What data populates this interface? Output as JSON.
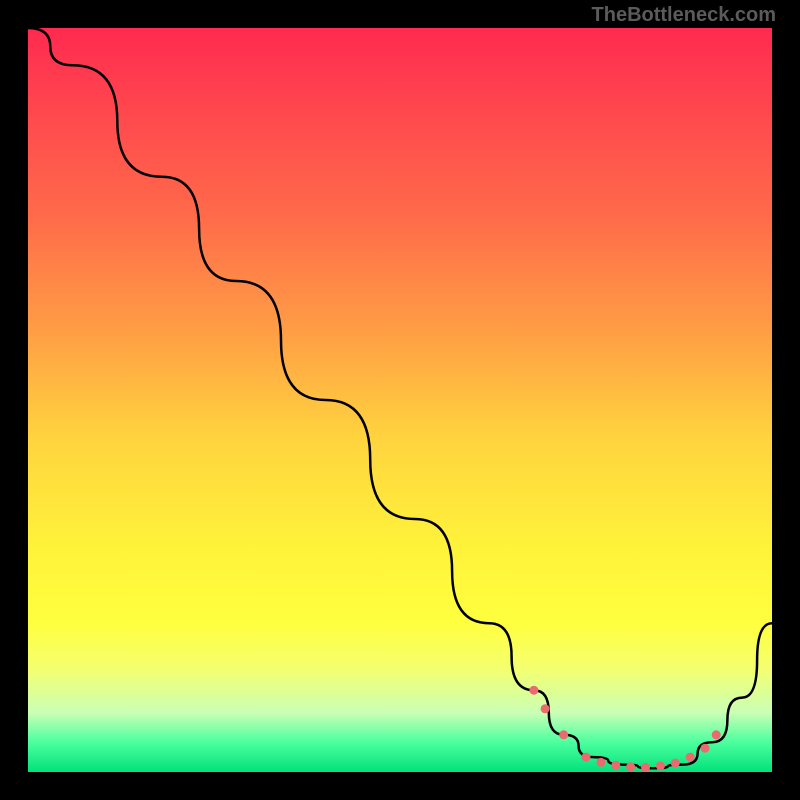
{
  "attribution": "TheBottleneck.com",
  "chart_data": {
    "type": "line",
    "title": "",
    "xlabel": "",
    "ylabel": "",
    "xlim": [
      0,
      100
    ],
    "ylim": [
      0,
      100
    ],
    "gradient_stops": [
      {
        "pos": 0,
        "color": "#ff2a4f"
      },
      {
        "pos": 8,
        "color": "#ff3f4f"
      },
      {
        "pos": 25,
        "color": "#ff6a4a"
      },
      {
        "pos": 40,
        "color": "#ff9b45"
      },
      {
        "pos": 55,
        "color": "#ffd33e"
      },
      {
        "pos": 70,
        "color": "#fff33a"
      },
      {
        "pos": 80,
        "color": "#ffff3e"
      },
      {
        "pos": 86,
        "color": "#f5ff6e"
      },
      {
        "pos": 92,
        "color": "#caffb5"
      },
      {
        "pos": 96,
        "color": "#4cff9f"
      },
      {
        "pos": 100,
        "color": "#00e27a"
      }
    ],
    "series": [
      {
        "name": "bottleneck-curve",
        "x": [
          0,
          6,
          18,
          28,
          40,
          52,
          62,
          68,
          72,
          76,
          80,
          84,
          88,
          92,
          96,
          100
        ],
        "y": [
          100,
          95,
          80,
          66,
          50,
          34,
          20,
          11,
          5,
          2,
          1,
          0.5,
          1,
          4,
          10,
          20
        ]
      }
    ],
    "markers": {
      "name": "highlight-dots",
      "color": "#ea6a6e",
      "size": 9,
      "points": [
        {
          "x": 68,
          "y": 11
        },
        {
          "x": 69.5,
          "y": 8.5
        },
        {
          "x": 72,
          "y": 5
        },
        {
          "x": 75,
          "y": 2
        },
        {
          "x": 77,
          "y": 1.3
        },
        {
          "x": 79,
          "y": 0.9
        },
        {
          "x": 81,
          "y": 0.7
        },
        {
          "x": 83,
          "y": 0.6
        },
        {
          "x": 85,
          "y": 0.8
        },
        {
          "x": 87,
          "y": 1.2
        },
        {
          "x": 89,
          "y": 2
        },
        {
          "x": 91,
          "y": 3.2
        },
        {
          "x": 92.5,
          "y": 5
        }
      ]
    }
  }
}
